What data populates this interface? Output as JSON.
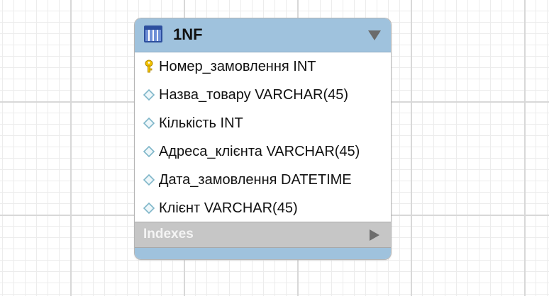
{
  "table": {
    "title": "1NF",
    "icon": "table-icon",
    "columns": [
      {
        "icon": "primary-key-icon",
        "text": "Номер_замовлення INT"
      },
      {
        "icon": "column-diamond-icon",
        "text": "Назва_товару VARCHAR(45)"
      },
      {
        "icon": "column-diamond-icon",
        "text": "Кількість INT"
      },
      {
        "icon": "column-diamond-icon",
        "text": "Адреса_клієнта VARCHAR(45)"
      },
      {
        "icon": "column-diamond-icon",
        "text": "Дата_замовлення DATETIME"
      },
      {
        "icon": "column-diamond-icon",
        "text": "Клієнт VARCHAR(45)"
      }
    ],
    "indexes_label": "Indexes"
  },
  "colors": {
    "header": "#9fc2dd",
    "indexes_bar": "#c6c6c6",
    "key_icon": "#f2c200",
    "diamond_icon": "#7fb6c9"
  }
}
